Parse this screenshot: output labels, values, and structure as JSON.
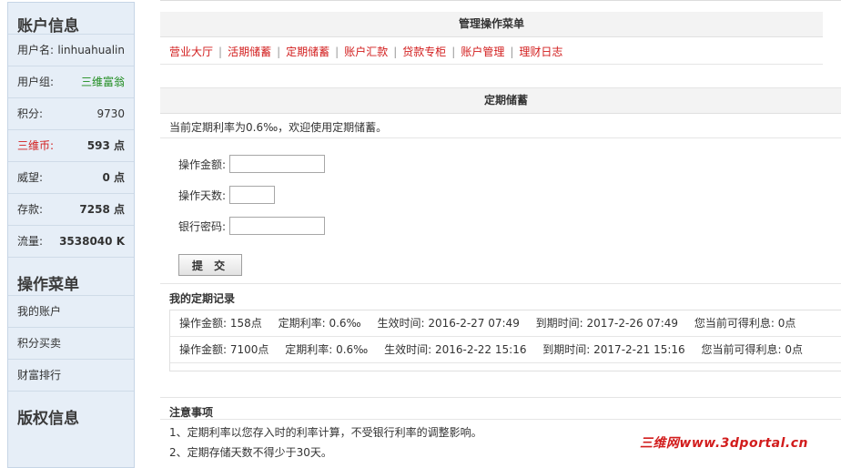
{
  "sidebar": {
    "account_title": "账户信息",
    "stats": [
      {
        "label": "用户名:",
        "value": "linhuahualin"
      },
      {
        "label": "用户组:",
        "value": "三维富翁"
      },
      {
        "label": "积分:",
        "value": "9730"
      },
      {
        "label": "三维币:",
        "value": "593 点"
      },
      {
        "label": "威望:",
        "value": "0 点"
      },
      {
        "label": "存款:",
        "value": "7258 点"
      },
      {
        "label": "流量:",
        "value": "3538040 K"
      }
    ],
    "menu_title": "操作菜单",
    "menu": [
      "我的账户",
      "积分买卖",
      "财富排行"
    ],
    "copyright_title": "版权信息"
  },
  "menu_panel": {
    "title": "管理操作菜单",
    "links": [
      "营业大厅",
      "活期储蓄",
      "定期储蓄",
      "账户汇款",
      "贷款专柜",
      "账户管理",
      "理财日志"
    ],
    "separator": "|"
  },
  "deposit": {
    "title": "定期储蓄",
    "rate_text": "当前定期利率为0.6‰，欢迎使用定期储蓄。",
    "form": {
      "amount_label": "操作金额:",
      "days_label": "操作天数:",
      "password_label": "银行密码:",
      "amount_value": "",
      "days_value": "",
      "password_value": ""
    },
    "submit_label": "提 交",
    "records_title": "我的定期记录",
    "records": [
      {
        "amount": "操作金额: 158点",
        "rate": "定期利率: 0.6‰",
        "start": "生效时间: 2016-2-27 07:49",
        "end": "到期时间: 2017-2-26 07:49",
        "interest": "您当前可得利息: 0点"
      },
      {
        "amount": "操作金额: 7100点",
        "rate": "定期利率: 0.6‰",
        "start": "生效时间: 2016-2-22 15:16",
        "end": "到期时间: 2017-2-21 15:16",
        "interest": "您当前可得利息: 0点"
      }
    ]
  },
  "notes": {
    "title": "注意事项",
    "lines": [
      "1、定期利率以您存入时的利率计算，不受银行利率的调整影响。",
      "2、定期存储天数不得少于30天。"
    ]
  },
  "watermark": "三维网www.3dportal.cn",
  "colors": {
    "link_red": "#d21d1d",
    "group_green": "#1b8a1b",
    "sidebar_bg": "#e6eef7"
  }
}
